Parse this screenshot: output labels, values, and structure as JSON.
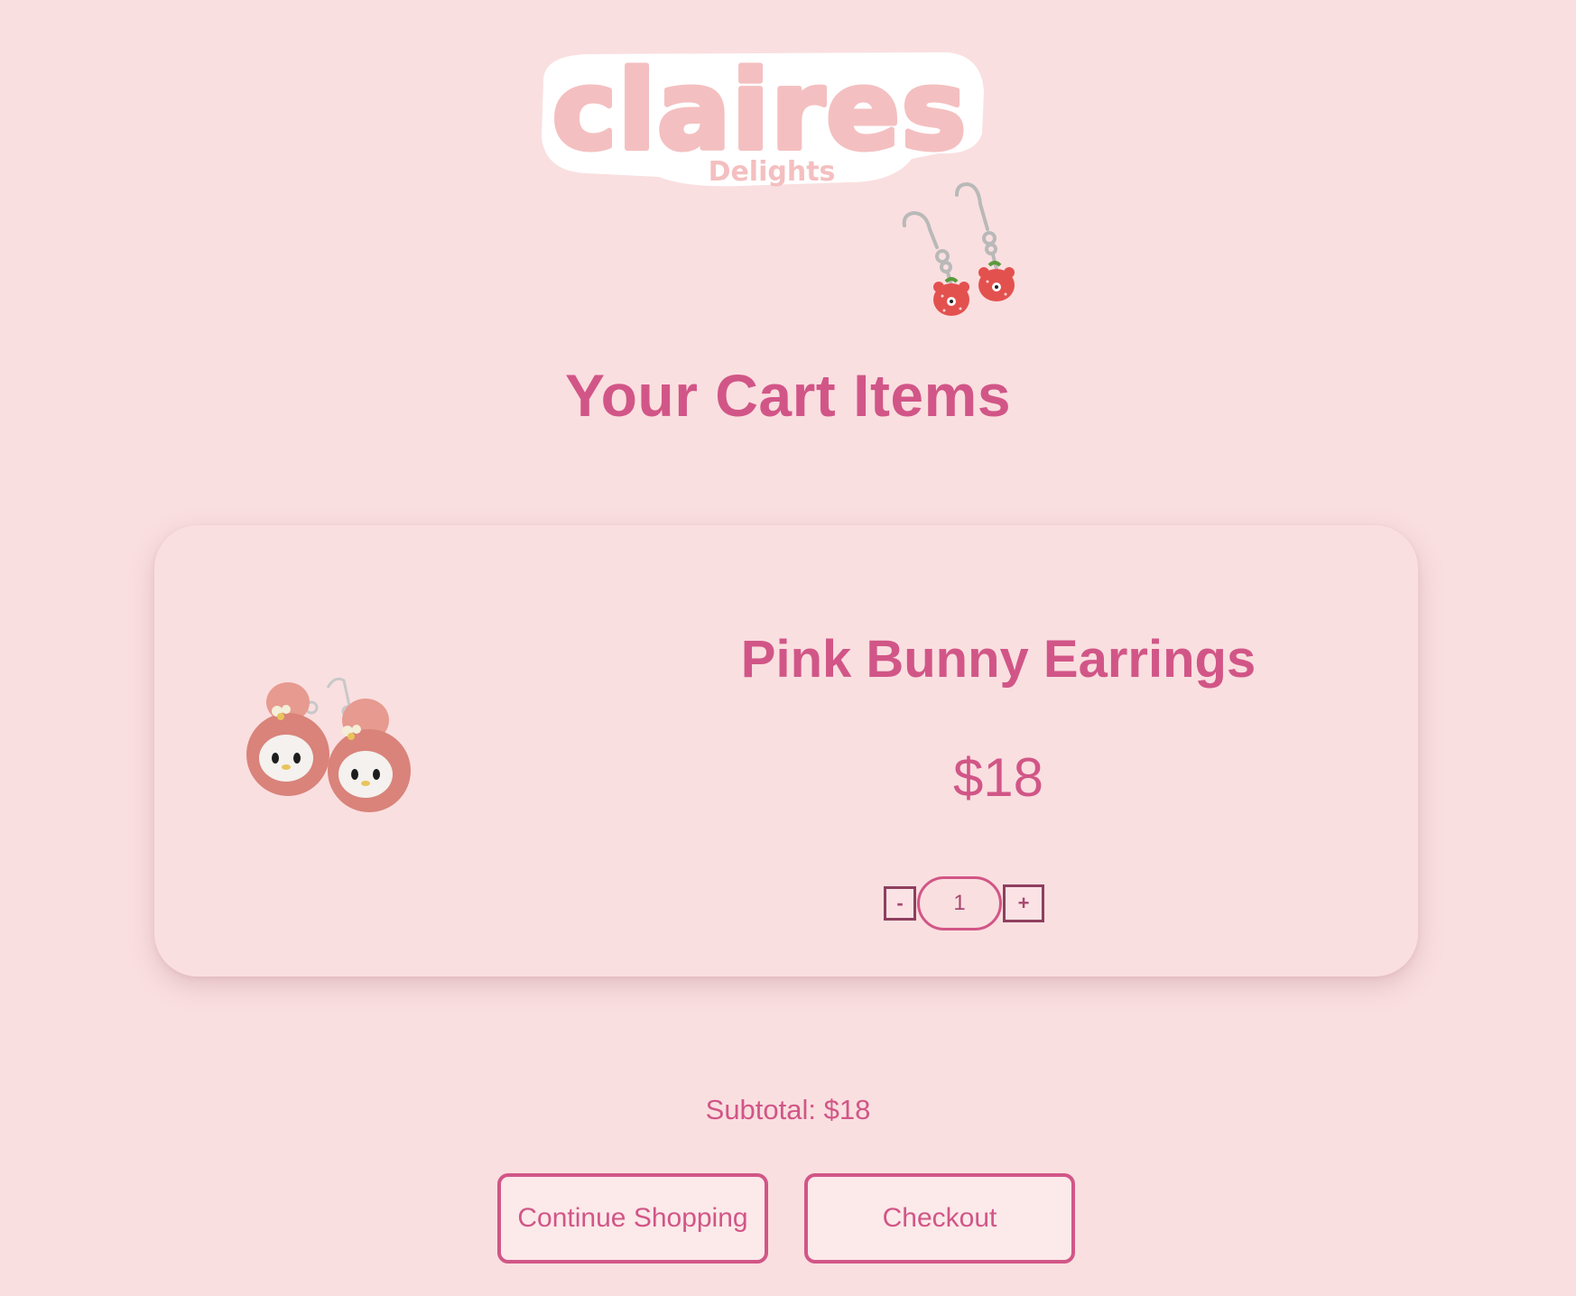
{
  "brand": {
    "logo_text": "claires",
    "logo_subtext": "Delights",
    "logo_fill": "#f4bfc0",
    "logo_outline": "#ffffff"
  },
  "decoration": {
    "icon": "strawberry-bear-earrings-icon"
  },
  "page": {
    "title": "Your Cart Items"
  },
  "cart": {
    "items": [
      {
        "name": "Pink Bunny Earrings",
        "price": "$18",
        "quantity": "1",
        "image_icon": "pink-bunny-earrings-icon",
        "decrement_label": "-",
        "increment_label": "+"
      }
    ]
  },
  "summary": {
    "subtotal": "Subtotal: $18"
  },
  "actions": {
    "continue_label": "Continue Shopping",
    "checkout_label": "Checkout"
  },
  "colors": {
    "background": "#fadfe0",
    "accent": "#d15687",
    "button_fill": "#fce9ea"
  }
}
